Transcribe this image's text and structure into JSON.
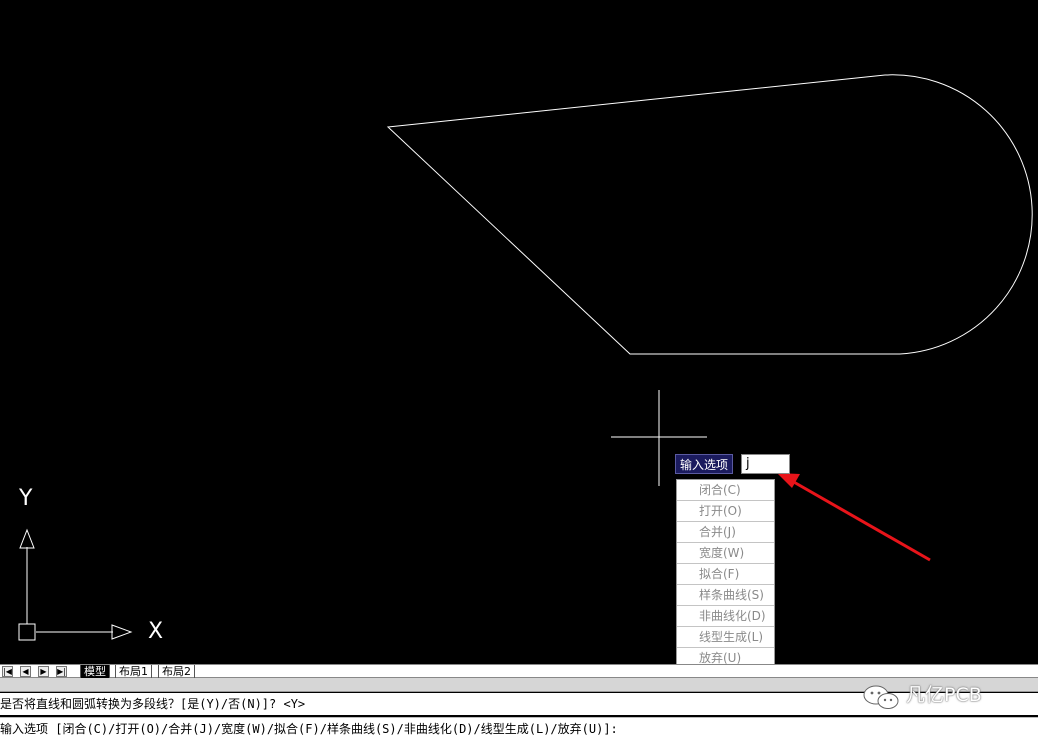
{
  "canvas": {
    "background": "#000000",
    "stroke": "#ffffff",
    "ucs": {
      "y_label": "Y",
      "x_label": "X"
    }
  },
  "dynamic_input": {
    "prompt_label": "输入选项",
    "value": "j",
    "options": [
      "闭合(C)",
      "打开(O)",
      "合并(J)",
      "宽度(W)",
      "拟合(F)",
      "样条曲线(S)",
      "非曲线化(D)",
      "线型生成(L)",
      "放弃(U)"
    ]
  },
  "tabs": {
    "nav": [
      "|◀",
      "◀",
      "▶",
      "▶|"
    ],
    "items": [
      "模型",
      "布局1",
      "布局2"
    ],
    "active": "模型"
  },
  "command_line": {
    "history": "是否将直线和圆弧转换为多段线？[是(Y)/否(N)]? <Y>",
    "current": "输入选项 [闭合(C)/打开(O)/合并(J)/宽度(W)/拟合(F)/样条曲线(S)/非曲线化(D)/线型生成(L)/放弃(U)]:"
  },
  "watermark": "凡亿PCB",
  "annotation_color": "#e8141a"
}
